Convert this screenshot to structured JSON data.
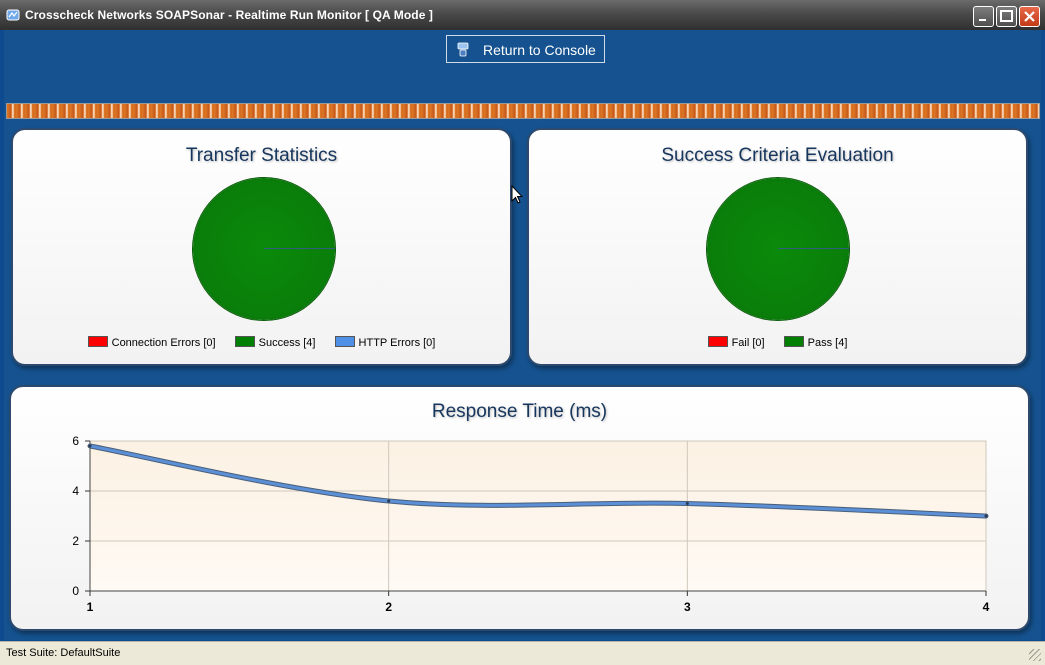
{
  "window": {
    "title": "Crosscheck Networks SOAPSonar - Realtime Run Monitor [ QA Mode ]"
  },
  "toolbar": {
    "return_label": "Return to Console"
  },
  "progress": {
    "fraction": 1.0
  },
  "transfer": {
    "title": "Transfer Statistics",
    "legend": [
      {
        "label": "Connection Errors [0]",
        "color": "#ff0000"
      },
      {
        "label": "Success [4]",
        "color": "#008000"
      },
      {
        "label": "HTTP Errors [0]",
        "color": "#4f8fe6"
      }
    ]
  },
  "criteria": {
    "title": "Success Criteria Evaluation",
    "legend": [
      {
        "label": "Fail [0]",
        "color": "#ff0000"
      },
      {
        "label": "Pass [4]",
        "color": "#008000"
      }
    ]
  },
  "response": {
    "title": "Response Time (ms)"
  },
  "chart_data": [
    {
      "type": "pie",
      "title": "Transfer Statistics",
      "categories": [
        "Connection Errors",
        "Success",
        "HTTP Errors"
      ],
      "values": [
        0,
        4,
        0
      ]
    },
    {
      "type": "pie",
      "title": "Success Criteria Evaluation",
      "categories": [
        "Fail",
        "Pass"
      ],
      "values": [
        0,
        4
      ]
    },
    {
      "type": "line",
      "title": "Response Time (ms)",
      "x": [
        1,
        2,
        3,
        4
      ],
      "series": [
        {
          "values": [
            5.8,
            3.6,
            3.5,
            3.0
          ],
          "color": "#5b8fd6"
        }
      ],
      "xlim": [
        1,
        4
      ],
      "ylim": [
        0,
        6
      ],
      "xticks": [
        "1",
        "2",
        "3",
        "4"
      ],
      "yticks": [
        "0",
        "2",
        "4",
        "6"
      ],
      "grid": true
    }
  ],
  "status": {
    "text": "Test Suite: DefaultSuite"
  }
}
